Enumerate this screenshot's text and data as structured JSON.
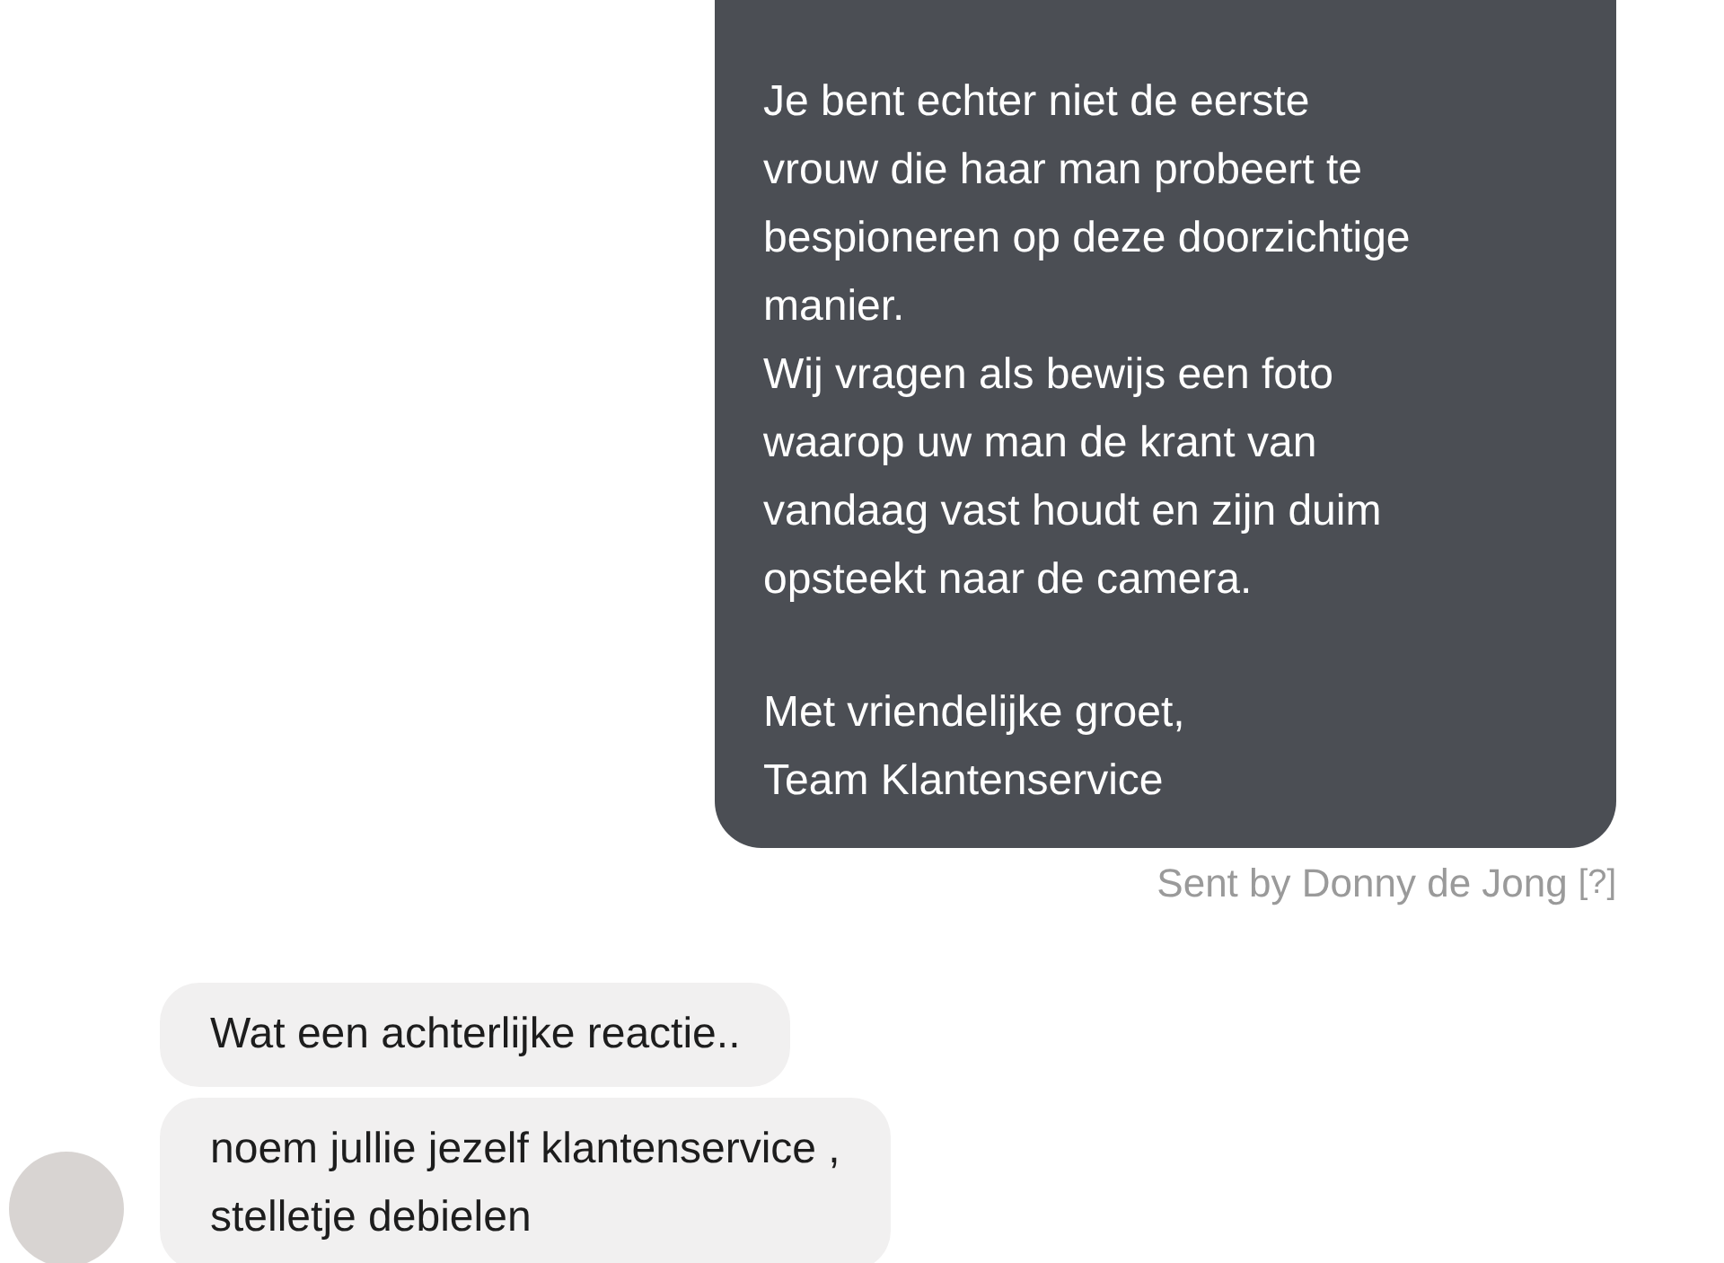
{
  "outgoing": {
    "paragraphs": [
      {
        "lines": [
          "Je bent echter niet de eerste",
          "vrouw die haar man probeert te",
          "bespioneren op deze doorzichtige",
          "manier.",
          "Wij vragen als bewijs een foto",
          "waarop uw man de krant van",
          "vandaag vast houdt en zijn duim",
          "opsteekt naar de camera."
        ]
      },
      {
        "lines": [
          "Met vriendelijke groet,",
          "Team Klantenservice"
        ]
      }
    ],
    "sent_by": "Sent by Donny de Jong",
    "help": "[?]"
  },
  "incoming": [
    {
      "lines": [
        "Wat een achterlijke reactie.."
      ]
    },
    {
      "lines": [
        "noem jullie jezelf klantenservice ,",
        "stelletje debielen"
      ]
    }
  ]
}
